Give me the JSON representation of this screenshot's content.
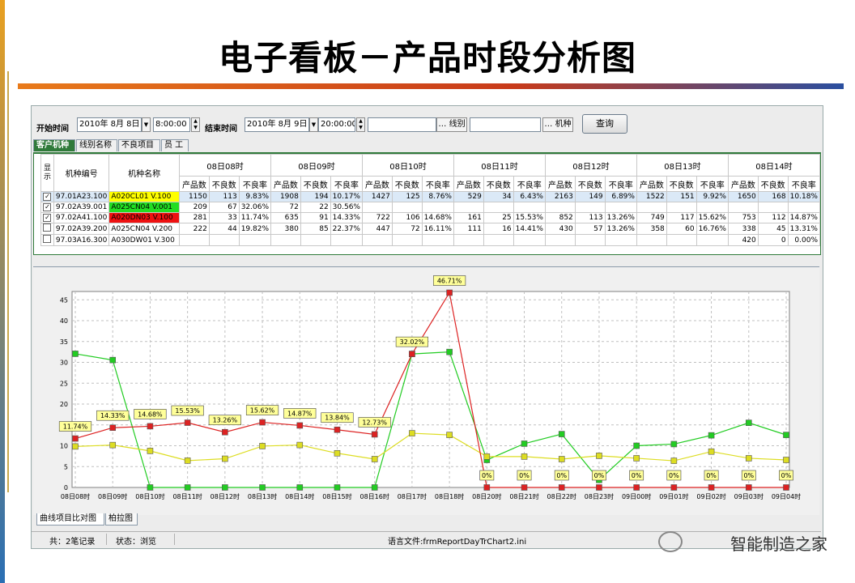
{
  "slide": {
    "title": "电子看板－产品时段分析图",
    "watermark": "智能制造之家"
  },
  "toolbar": {
    "start_label": "开始时间",
    "start_date": "2010年  8月  8日",
    "start_time": "8:00:00",
    "end_label": "结束时间",
    "end_date": "2010年  8月  9日",
    "end_time": "20:00:00",
    "line_btn": "… 线别",
    "machine_btn": "… 机种",
    "line_value": "",
    "machine_value": "",
    "query": "查询"
  },
  "tabs": [
    "客户机种",
    "线别名称",
    "不良项目",
    "员 工"
  ],
  "table": {
    "col_show": "显示",
    "col_code": "机种编号",
    "col_name": "机种名称",
    "periods": [
      "08日08时",
      "08日09时",
      "08日10时",
      "08日11时",
      "08日12时",
      "08日13时",
      "08日14时"
    ],
    "sub_headers": [
      "产品数",
      "不良数",
      "不良率"
    ],
    "rows": [
      {
        "checked": true,
        "code": "97.01A23.100",
        "name": "A020CL01 V.100",
        "name_bg": "#ffff00",
        "cells": [
          "1150",
          "113",
          "9.83%",
          "1908",
          "194",
          "10.17%",
          "1427",
          "125",
          "8.76%",
          "529",
          "34",
          "6.43%",
          "2163",
          "149",
          "6.89%",
          "1522",
          "151",
          "9.92%",
          "1650",
          "168",
          "10.18%"
        ]
      },
      {
        "checked": true,
        "code": "97.02A39.001",
        "name": "A025CN04 V.001",
        "name_bg": "#22dd22",
        "cells": [
          "209",
          "67",
          "32.06%",
          "72",
          "22",
          "30.56%",
          "",
          "",
          "",
          "",
          "",
          "",
          "",
          "",
          "",
          "",
          "",
          "",
          "",
          "",
          ""
        ]
      },
      {
        "checked": true,
        "code": "97.02A41.100",
        "name": "A020DN03 V.100",
        "name_bg": "#ee1111",
        "cells": [
          "281",
          "33",
          "11.74%",
          "635",
          "91",
          "14.33%",
          "722",
          "106",
          "14.68%",
          "161",
          "25",
          "15.53%",
          "852",
          "113",
          "13.26%",
          "749",
          "117",
          "15.62%",
          "753",
          "112",
          "14.87%"
        ]
      },
      {
        "checked": false,
        "code": "97.02A39.200",
        "name": "A025CN04 V.200",
        "name_bg": "",
        "cells": [
          "222",
          "44",
          "19.82%",
          "380",
          "85",
          "22.37%",
          "447",
          "72",
          "16.11%",
          "111",
          "16",
          "14.41%",
          "430",
          "57",
          "13.26%",
          "358",
          "60",
          "16.76%",
          "338",
          "45",
          "13.31%"
        ]
      },
      {
        "checked": false,
        "code": "97.03A16.300",
        "name": "A030DW01 V.300",
        "name_bg": "",
        "cells": [
          "",
          "",
          "",
          "",
          "",
          "",
          "",
          "",
          "",
          "",
          "",
          "",
          "",
          "",
          "",
          "",
          "",
          "",
          "420",
          "0",
          "0.00%"
        ]
      }
    ]
  },
  "chart_data": {
    "type": "line",
    "categories": [
      "08日08时",
      "08日09时",
      "08日10时",
      "08日11时",
      "08日12时",
      "08日13时",
      "08日14时",
      "08日15时",
      "08日16时",
      "08日17时",
      "08日18时",
      "08日20时",
      "08日21时",
      "08日22时",
      "08日23时",
      "09日00时",
      "09日01时",
      "09日02时",
      "09日03时",
      "09日04时"
    ],
    "ylim": [
      0,
      47
    ],
    "yticks": [
      0,
      5,
      10,
      15,
      20,
      25,
      30,
      35,
      40,
      45
    ],
    "grid": true,
    "series": [
      {
        "color": "#22cc22",
        "values": [
          32.06,
          30.56,
          0,
          0,
          0,
          0,
          0,
          0,
          0,
          32.02,
          32.5,
          6.6,
          10.5,
          12.8,
          1.8,
          10.0,
          10.4,
          12.5,
          15.5,
          12.6
        ]
      },
      {
        "color": "#dddd22",
        "values": [
          9.83,
          10.17,
          8.76,
          6.43,
          6.89,
          9.92,
          10.18,
          8.2,
          6.8,
          13.0,
          12.6,
          7.4,
          7.4,
          6.8,
          7.6,
          7.0,
          6.4,
          8.6,
          7.0,
          6.6
        ]
      },
      {
        "color": "#dd2222",
        "values": [
          11.74,
          14.33,
          14.68,
          15.53,
          13.26,
          15.62,
          14.87,
          13.84,
          12.73,
          32.02,
          46.71,
          0,
          0,
          0,
          0,
          0,
          0,
          0,
          0,
          0
        ]
      }
    ],
    "labels": [
      "11.74%",
      "14.33%",
      "14.68%",
      "15.53%",
      "13.26%",
      "15.62%",
      "14.87%",
      "13.84%",
      "12.73%",
      "32.02%",
      "46.71%",
      "0%",
      "0%",
      "0%",
      "0%",
      "0%",
      "0%",
      "0%",
      "0%",
      "0%"
    ]
  },
  "bottom_tabs": [
    "曲线项目比对图",
    "柏拉图"
  ],
  "status": {
    "records": "共：2笔记录",
    "state": "状态：浏览",
    "lang": "语言文件:frmReportDayTrChart2.ini"
  }
}
